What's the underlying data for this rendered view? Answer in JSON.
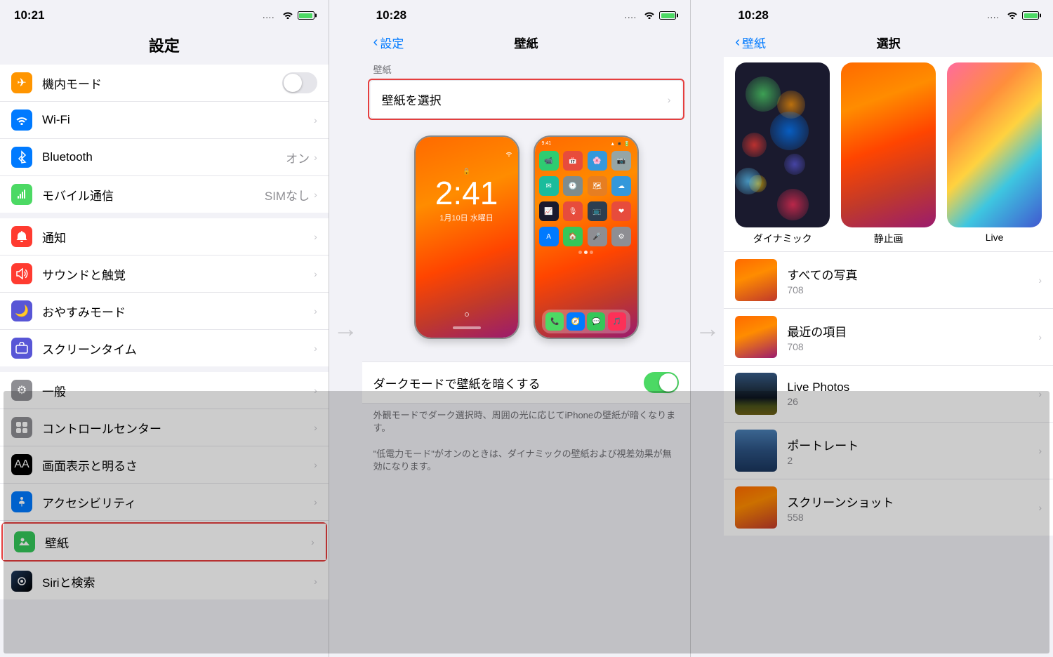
{
  "panel1": {
    "statusBar": {
      "time": "10:21",
      "signal": "....",
      "wifi": "wifi",
      "battery": "charging"
    },
    "title": "設定",
    "sections": [
      {
        "items": [
          {
            "id": "airplane",
            "label": "機内モード",
            "icon_bg": "#ff9500",
            "icon": "✈",
            "value": "",
            "has_toggle": true,
            "toggle_on": false
          },
          {
            "id": "wifi",
            "label": "Wi-Fi",
            "icon_bg": "#007aff",
            "icon": "wifi",
            "value": "",
            "has_chevron": true
          },
          {
            "id": "bluetooth",
            "label": "Bluetooth",
            "icon_bg": "#007aff",
            "icon": "bt",
            "value": "オン",
            "has_chevron": true
          },
          {
            "id": "mobile",
            "label": "モバイル通信",
            "icon_bg": "#4cd964",
            "icon": "📶",
            "value": "SIMなし",
            "has_chevron": true
          }
        ]
      },
      {
        "items": [
          {
            "id": "notifications",
            "label": "通知",
            "icon_bg": "#ff3b30",
            "icon": "🔔",
            "value": "",
            "has_chevron": true
          },
          {
            "id": "sounds",
            "label": "サウンドと触覚",
            "icon_bg": "#ff3b30",
            "icon": "🔊",
            "value": "",
            "has_chevron": true
          },
          {
            "id": "donotdisturb",
            "label": "おやすみモード",
            "icon_bg": "#5856d6",
            "icon": "🌙",
            "value": "",
            "has_chevron": true
          },
          {
            "id": "screentime",
            "label": "スクリーンタイム",
            "icon_bg": "#5856d6",
            "icon": "⏳",
            "value": "",
            "has_chevron": true
          }
        ]
      },
      {
        "items": [
          {
            "id": "general",
            "label": "一般",
            "icon_bg": "#8e8e93",
            "icon": "⚙",
            "value": "",
            "has_chevron": true
          },
          {
            "id": "controlcenter",
            "label": "コントロールセンター",
            "icon_bg": "#8e8e93",
            "icon": "⊞",
            "value": "",
            "has_chevron": true
          },
          {
            "id": "display",
            "label": "画面表示と明るさ",
            "icon_bg": "#000",
            "icon": "AA",
            "value": "",
            "has_chevron": true
          },
          {
            "id": "accessibility",
            "label": "アクセシビリティ",
            "icon_bg": "#007aff",
            "icon": "♿",
            "value": "",
            "has_chevron": true
          },
          {
            "id": "wallpaper",
            "label": "壁紙",
            "icon_bg": "#34c759",
            "icon": "🌸",
            "value": "",
            "has_chevron": true,
            "highlighted": true
          },
          {
            "id": "siri",
            "label": "Siriと検索",
            "icon_bg": "#000",
            "icon": "◉",
            "value": "",
            "has_chevron": true
          }
        ]
      }
    ]
  },
  "panel2": {
    "statusBar": {
      "time": "10:28"
    },
    "backLabel": "設定",
    "title": "壁紙",
    "sectionLabel": "壁紙",
    "selectWallpaperLabel": "壁紙を選択",
    "lockScreenTime": "2:41",
    "lockScreenDate": "1月10日 水曜日",
    "darkModeLabel": "ダークモードで壁紙を暗くする",
    "darkModeDesc": "外観モードでダーク選択時、周囲の光に応じてiPhoneの壁紙が暗くなります。\n\n\"低電力モード\"がオンのときは、ダイナミックの壁紙および視差効果が無効になります。"
  },
  "panel3": {
    "statusBar": {
      "time": "10:28"
    },
    "backLabel": "壁紙",
    "title": "選択",
    "wallpaperTypes": [
      {
        "id": "dynamic",
        "label": "ダイナミック"
      },
      {
        "id": "static",
        "label": "静止画"
      },
      {
        "id": "live",
        "label": "Live"
      }
    ],
    "photoCategories": [
      {
        "id": "all",
        "name": "すべての写真",
        "count": "708"
      },
      {
        "id": "recent",
        "name": "最近の項目",
        "count": "708"
      },
      {
        "id": "livephotos",
        "name": "Live Photos",
        "count": "26"
      },
      {
        "id": "portrait",
        "name": "ポートレート",
        "count": "2"
      },
      {
        "id": "screenshots",
        "name": "スクリーンショット",
        "count": "558"
      }
    ]
  }
}
